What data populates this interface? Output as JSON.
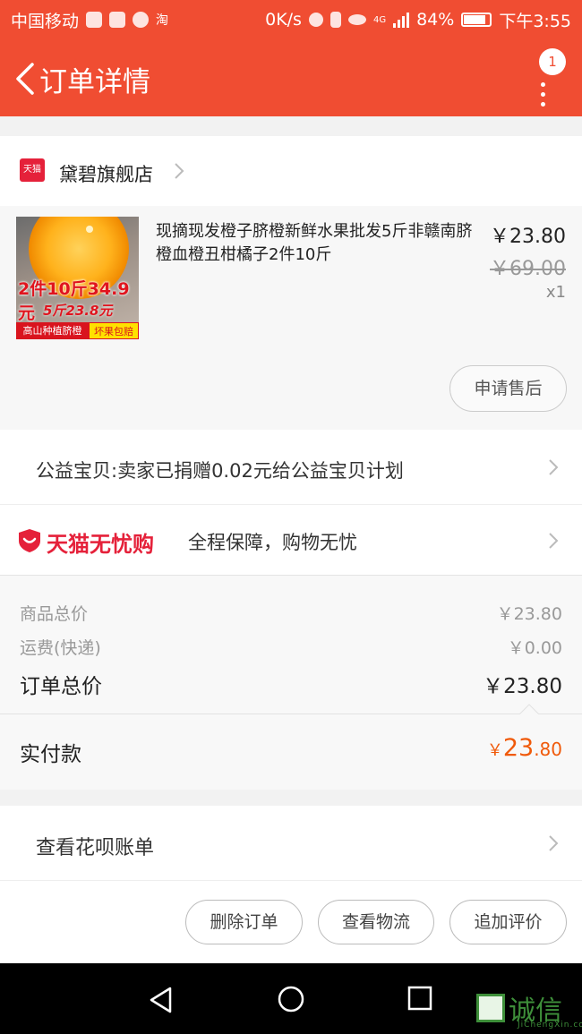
{
  "status_bar": {
    "carrier": "中国移动",
    "net_speed": "0K/s",
    "battery": "84%",
    "time": "下午3:55",
    "network_type": "4G"
  },
  "header": {
    "title": "订单详情",
    "notification_count": "1"
  },
  "shop": {
    "logo_text": "天猫",
    "name": "黛碧旗舰店"
  },
  "product": {
    "title": "现摘现发橙子脐橙新鲜水果批发5斤非赣南脐橙血橙丑柑橘子2件10斤",
    "price": "￥23.80",
    "original_price": "￥69.00",
    "quantity": "x1",
    "image_text": {
      "promo_main": "2件10斤34.9元",
      "promo_sub": "5斤23.8元",
      "banner_left": "高山种植脐橙",
      "banner_right": "坏果包赔"
    },
    "after_sale_label": "申请售后"
  },
  "charity": {
    "text": "公益宝贝:卖家已捐赠0.02元给公益宝贝计划"
  },
  "guarantee": {
    "brand": "天猫无忧购",
    "text": "全程保障，购物无忧"
  },
  "summary": {
    "goods_total_label": "商品总价",
    "goods_total_value": "￥23.80",
    "shipping_label": "运费(快递)",
    "shipping_value": "￥0.00",
    "order_total_label": "订单总价",
    "order_total_value": "￥23.80",
    "paid_label": "实付款",
    "paid_currency": "￥",
    "paid_integer": "23",
    "paid_decimal": ".80"
  },
  "huabei": {
    "text": "查看花呗账单"
  },
  "actions": {
    "delete": "删除订单",
    "logistics": "查看物流",
    "review": "追加评价"
  },
  "watermark": {
    "text": "诚信",
    "sub": "JiChengXin.com"
  },
  "colors": {
    "accent": "#f04d32",
    "tmall_red": "#e5213a",
    "paid_orange": "#f05a0a"
  }
}
